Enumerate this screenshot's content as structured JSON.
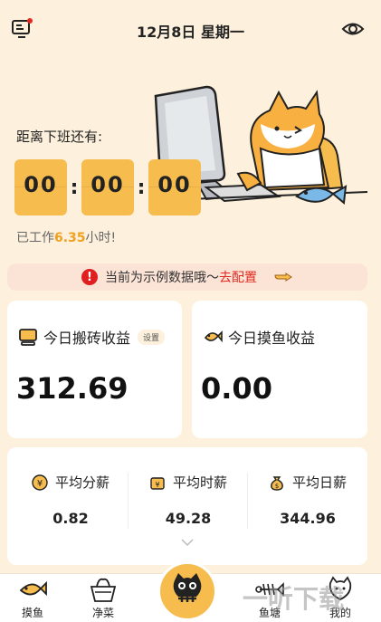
{
  "header": {
    "title": "12月8日 星期一",
    "left_icon": "monitor-icon",
    "right_icon": "eye-icon",
    "accent": "#e02a20"
  },
  "countdown": {
    "label": "距离下班还有:",
    "hours": "00",
    "minutes": "00",
    "seconds": "00",
    "worked_prefix": "已工作",
    "worked_value": "6.35",
    "worked_suffix": "小时!"
  },
  "notice": {
    "text": "当前为示例数据哦～",
    "link": "去配置"
  },
  "earnings": [
    {
      "title": "今日搬砖收益",
      "badge": "设置",
      "value": "312.69",
      "icon": "computer-icon"
    },
    {
      "title": "今日摸鱼收益",
      "value": "0.00",
      "icon": "fish-icon"
    }
  ],
  "stats": [
    {
      "title": "平均分薪",
      "value": "0.82",
      "icon": "coin-icon"
    },
    {
      "title": "平均时薪",
      "value": "49.28",
      "icon": "wallet-icon"
    },
    {
      "title": "平均日薪",
      "value": "344.96",
      "icon": "money-bag-icon"
    }
  ],
  "tabs": [
    {
      "label": "摸鱼",
      "icon": "fish-tab-icon"
    },
    {
      "label": "净菜",
      "icon": "basket-icon"
    },
    {
      "label": "鱼塘",
      "icon": "fishbone-icon"
    },
    {
      "label": "我的",
      "icon": "cat-icon"
    }
  ],
  "watermark": "一听下载",
  "colors": {
    "background": "#fdf0dc",
    "timer": "#f6bd4e",
    "highlight": "#f0a020"
  }
}
